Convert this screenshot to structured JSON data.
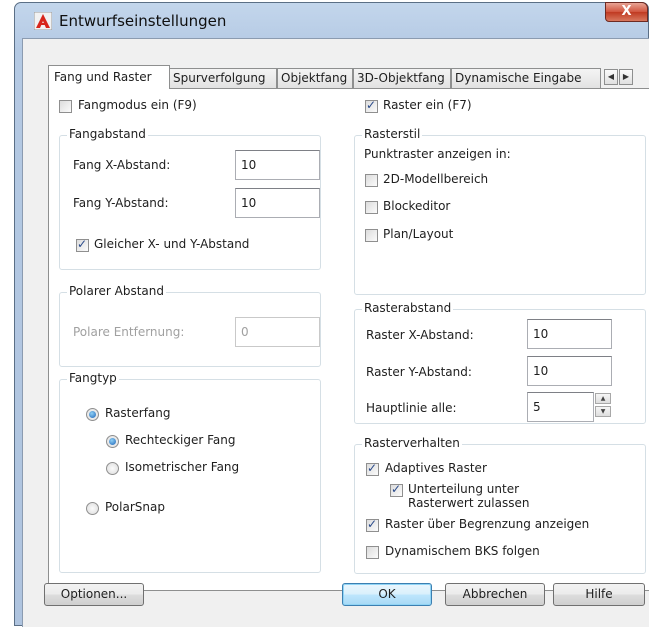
{
  "window": {
    "title": "Entwurfseinstellungen",
    "close_glyph": "X",
    "app_icon": "autocad-icon"
  },
  "tabs": [
    {
      "label": "Fang und Raster",
      "active": true
    },
    {
      "label": "Spurverfolgung",
      "active": false
    },
    {
      "label": "Objektfang",
      "active": false
    },
    {
      "label": "3D-Objektfang",
      "active": false
    },
    {
      "label": "Dynamische Eingabe",
      "active": false
    }
  ],
  "tab_scroll": {
    "left_glyph": "◀",
    "right_glyph": "▶"
  },
  "snap": {
    "snap_mode_label": "Fangmodus ein (F9)",
    "snap_mode_checked": false,
    "spacing_group": "Fangabstand",
    "x_label": "Fang X-Abstand:",
    "x_value": "10",
    "y_label": "Fang Y-Abstand:",
    "y_value": "10",
    "equal_label": "Gleicher X- und Y-Abstand",
    "equal_checked": true
  },
  "polar": {
    "group": "Polarer Abstand",
    "distance_label": "Polare Entfernung:",
    "distance_value": "0"
  },
  "snap_type": {
    "group": "Fangtyp",
    "grid_snap": "Rasterfang",
    "rect_snap": "Rechteckiger Fang",
    "iso_snap": "Isometrischer Fang",
    "polar_snap": "PolarSnap"
  },
  "grid": {
    "grid_on_label": "Raster ein (F7)",
    "grid_on_checked": true,
    "style_group": "Rasterstil",
    "style_hint": "Punktraster anzeigen in:",
    "model_space": "2D-Modellbereich",
    "block_editor": "Blockeditor",
    "layout": "Plan/Layout",
    "spacing_group": "Rasterabstand",
    "x_label": "Raster X-Abstand:",
    "x_value": "10",
    "y_label": "Raster Y-Abstand:",
    "y_value": "10",
    "major_label": "Hauptlinie alle:",
    "major_value": "5",
    "behavior_group": "Rasterverhalten",
    "adaptive": "Adaptives Raster",
    "subdivision_line1": "Unterteilung unter",
    "subdivision_line2": "Rasterwert zulassen",
    "beyond_limits": "Raster über Begrenzung anzeigen",
    "follow_ucs": "Dynamischem BKS folgen"
  },
  "buttons": {
    "options": "Optionen...",
    "ok": "OK",
    "cancel": "Abbrechen",
    "help": "Hilfe"
  }
}
